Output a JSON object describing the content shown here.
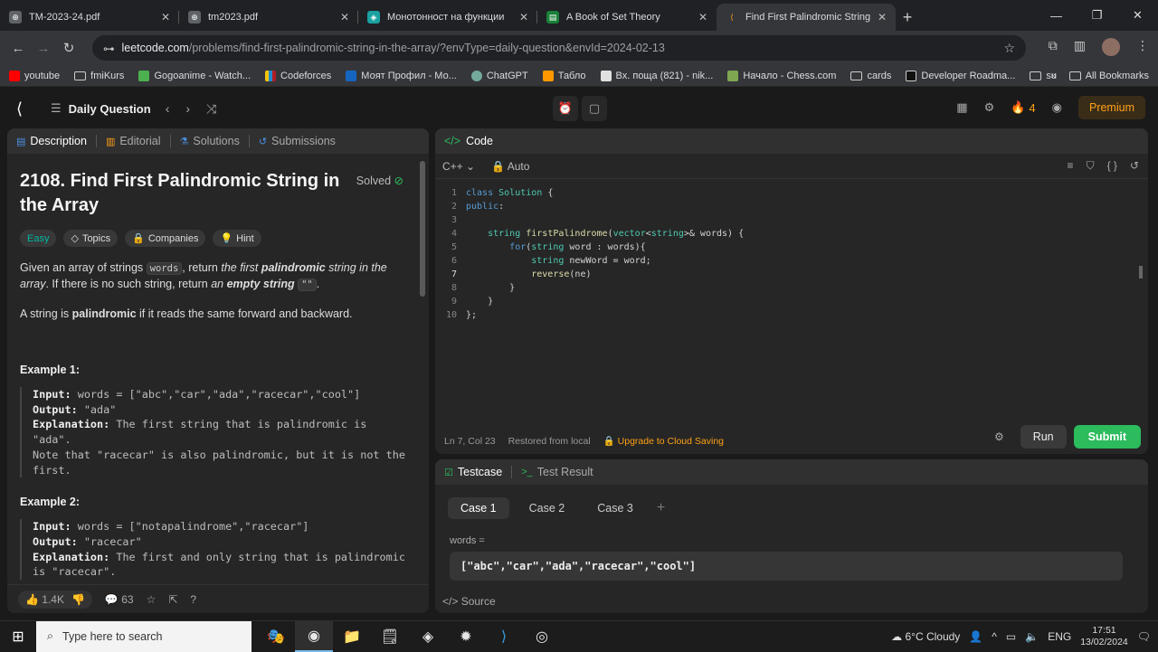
{
  "browser": {
    "tabs": [
      {
        "title": "TM-2023-24.pdf",
        "icon": "pdf-icon",
        "color": "#5f6368"
      },
      {
        "title": "tm2023.pdf",
        "icon": "globe-icon",
        "color": "#5f6368"
      },
      {
        "title": "Монотонност на функции",
        "icon": "gemini-icon",
        "color": "#1aa1a1"
      },
      {
        "title": "A Book of Set Theory",
        "icon": "doc-icon",
        "color": "#188038"
      },
      {
        "title": "Find First Palindromic String in",
        "icon": "leetcode-icon",
        "color": "#ffa116"
      }
    ],
    "url_host": "leetcode.com",
    "url_path": "/problems/find-first-palindromic-string-in-the-array/?envType=daily-question&envId=2024-02-13",
    "bookmarks": [
      "youtube",
      "fmiKurs",
      "Gogoanime - Watch...",
      "Codeforces",
      "Моят Профил - Мо...",
      "ChatGPT",
      "Табло",
      "Вх. поща (821) - nik...",
      "Начало - Chess.com",
      "cards",
      "Developer Roadma...",
      "su"
    ],
    "all_bookmarks": "All Bookmarks"
  },
  "nav": {
    "daily_question": "Daily Question",
    "streak": "4",
    "premium": "Premium"
  },
  "desc": {
    "tabs": [
      "Description",
      "Editorial",
      "Solutions",
      "Submissions"
    ],
    "title": "2108. Find First Palindromic String in the Array",
    "solved": "Solved",
    "tags": [
      "Easy",
      "Topics",
      "Companies",
      "Hint"
    ],
    "p1_a": "Given an array of strings ",
    "p1_code": "words",
    "p1_b": ", return ",
    "p1_c": "the first ",
    "p1_d": "palindromic",
    "p1_e": " string in the array",
    "p1_f": ". If there is no such string, return ",
    "p1_g": "an ",
    "p1_h": "empty string",
    "p1_i": " ",
    "p1_code2": "\"\"",
    "p1_j": ".",
    "p2_a": "A string is ",
    "p2_b": "palindromic",
    "p2_c": " if it reads the same forward and backward.",
    "ex1_title": "Example 1:",
    "ex2_title": "Example 2:",
    "ex1": {
      "input_label": "Input:",
      "input": " words = [\"abc\",\"car\",\"ada\",\"racecar\",\"cool\"]",
      "output_label": "Output:",
      "output": " \"ada\"",
      "expl_label": "Explanation:",
      "expl": " The first string that is palindromic is\n\"ada\".\nNote that \"racecar\" is also palindromic, but it is not the\nfirst."
    },
    "ex2": {
      "input_label": "Input:",
      "input": " words = [\"notapalindrome\",\"racecar\"]",
      "output_label": "Output:",
      "output": " \"racecar\"",
      "expl_label": "Explanation:",
      "expl": " The first and only string that is palindromic\nis \"racecar\"."
    },
    "likes": "1.4K",
    "comments": "63"
  },
  "code": {
    "header": "Code",
    "language": "C++",
    "autosave": "Auto",
    "status_pos": "Ln 7, Col 23",
    "status_restore": "Restored from local",
    "status_upgrade": "Upgrade to Cloud Saving",
    "run": "Run",
    "submit": "Submit"
  },
  "test": {
    "tab_testcase": "Testcase",
    "tab_result": "Test Result",
    "cases": [
      "Case 1",
      "Case 2",
      "Case 3"
    ],
    "input_label": "words =",
    "input_value": "[\"abc\",\"car\",\"ada\",\"racecar\",\"cool\"]",
    "source": "Source"
  },
  "taskbar": {
    "search_placeholder": "Type here to search",
    "weather": "6°C  Cloudy",
    "lang": "ENG",
    "time": "17:51",
    "date": "13/02/2024"
  }
}
